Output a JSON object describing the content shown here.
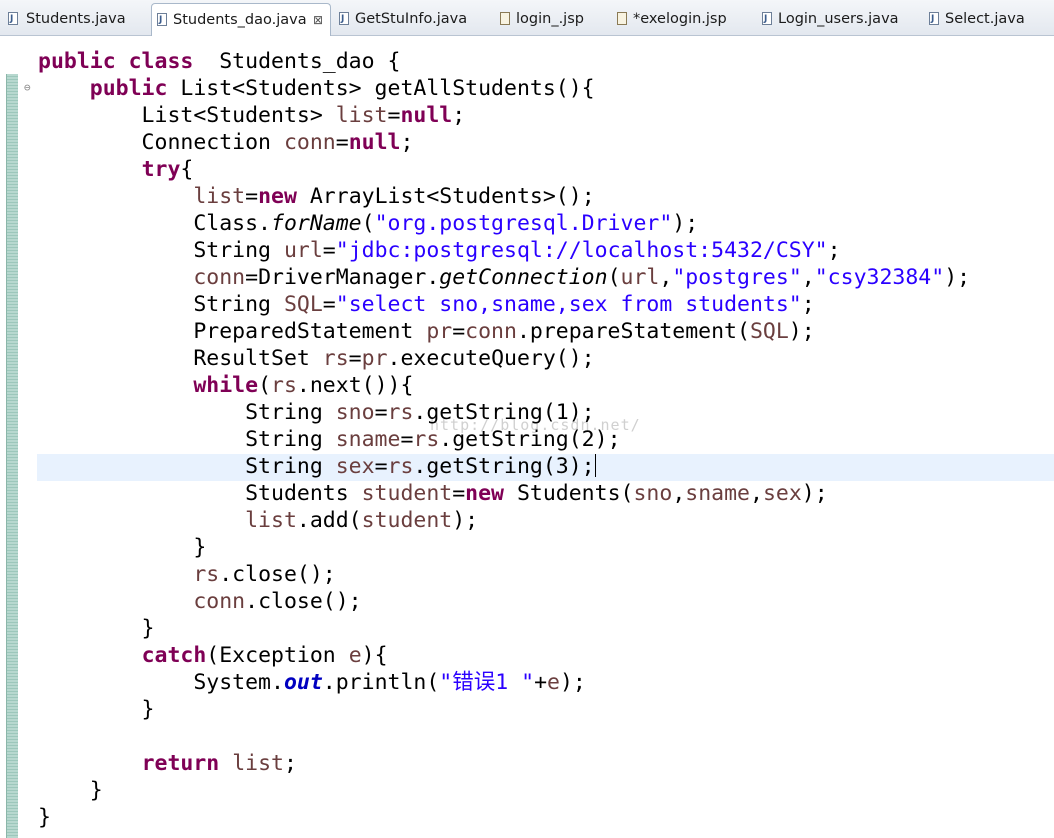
{
  "editor": {
    "tabs": [
      {
        "label": "Students.java",
        "icon": "java-file-icon"
      },
      {
        "label": "Students_dao.java",
        "icon": "java-file-icon",
        "active": true,
        "close": "⊠"
      },
      {
        "label": "GetStuInfo.java",
        "icon": "java-file-icon"
      },
      {
        "label": "login_.jsp",
        "icon": "jsp-file-icon"
      },
      {
        "label": "*exelogin.jsp",
        "icon": "jsp-file-icon"
      },
      {
        "label": "Login_users.java",
        "icon": "java-file-icon"
      },
      {
        "label": "Select.java",
        "icon": "java-file-icon"
      }
    ],
    "fold_marker": "⊖",
    "watermark": "http://blog.csdn.net/",
    "colors": {
      "keyword": "#7f0055",
      "string": "#2a00ff",
      "variable": "#6a3e3e",
      "field": "#0000c0",
      "current_line": "#e8f2fe"
    },
    "lines": [
      [
        [
          "kw",
          "public class"
        ],
        [
          "",
          "  Students_dao {"
        ]
      ],
      [
        [
          "",
          "    "
        ],
        [
          "kw",
          "public"
        ],
        [
          "",
          " List<Students> getAllStudents(){"
        ]
      ],
      [
        [
          "",
          "        List<Students> "
        ],
        [
          "var",
          "list"
        ],
        [
          "",
          "="
        ],
        [
          "kw",
          "null"
        ],
        [
          "",
          ";"
        ]
      ],
      [
        [
          "",
          "        Connection "
        ],
        [
          "var",
          "conn"
        ],
        [
          "",
          "="
        ],
        [
          "kw",
          "null"
        ],
        [
          "",
          ";"
        ]
      ],
      [
        [
          "",
          "        "
        ],
        [
          "kw",
          "try"
        ],
        [
          "",
          "{"
        ]
      ],
      [
        [
          "",
          "            "
        ],
        [
          "var",
          "list"
        ],
        [
          "",
          "="
        ],
        [
          "kw",
          "new"
        ],
        [
          "",
          " ArrayList<Students>();"
        ]
      ],
      [
        [
          "",
          "            Class."
        ],
        [
          "sm",
          "forName"
        ],
        [
          "",
          "("
        ],
        [
          "str",
          "\"org.postgresql.Driver\""
        ],
        [
          "",
          ");"
        ]
      ],
      [
        [
          "",
          "            String "
        ],
        [
          "var",
          "url"
        ],
        [
          "",
          "="
        ],
        [
          "str",
          "\"jdbc:postgresql://localhost:5432/CSY\""
        ],
        [
          "",
          ";"
        ]
      ],
      [
        [
          "",
          "            "
        ],
        [
          "var",
          "conn"
        ],
        [
          "",
          "=DriverManager."
        ],
        [
          "sm",
          "getConnection"
        ],
        [
          "",
          "("
        ],
        [
          "var",
          "url"
        ],
        [
          "",
          ","
        ],
        [
          "str",
          "\"postgres\""
        ],
        [
          "",
          ","
        ],
        [
          "str",
          "\"csy32384\""
        ],
        [
          "",
          ");"
        ]
      ],
      [
        [
          "",
          "            String "
        ],
        [
          "var",
          "SQL"
        ],
        [
          "",
          "="
        ],
        [
          "str",
          "\"select sno,sname,sex from students\""
        ],
        [
          "",
          ";"
        ]
      ],
      [
        [
          "",
          "            PreparedStatement "
        ],
        [
          "var",
          "pr"
        ],
        [
          "",
          "="
        ],
        [
          "var",
          "conn"
        ],
        [
          "",
          ".prepareStatement("
        ],
        [
          "var",
          "SQL"
        ],
        [
          "",
          ");"
        ]
      ],
      [
        [
          "",
          "            ResultSet "
        ],
        [
          "var",
          "rs"
        ],
        [
          "",
          "="
        ],
        [
          "var",
          "pr"
        ],
        [
          "",
          ".executeQuery();"
        ]
      ],
      [
        [
          "",
          "            "
        ],
        [
          "kw",
          "while"
        ],
        [
          "",
          "("
        ],
        [
          "var",
          "rs"
        ],
        [
          "",
          ".next()){"
        ]
      ],
      [
        [
          "",
          "                String "
        ],
        [
          "var",
          "sno"
        ],
        [
          "",
          "="
        ],
        [
          "var",
          "rs"
        ],
        [
          "",
          ".getString(1);"
        ]
      ],
      [
        [
          "",
          "                String "
        ],
        [
          "var",
          "sname"
        ],
        [
          "",
          "="
        ],
        [
          "var",
          "rs"
        ],
        [
          "",
          ".getString(2);"
        ]
      ],
      [
        [
          "",
          "                String "
        ],
        [
          "var",
          "sex"
        ],
        [
          "",
          "="
        ],
        [
          "var",
          "rs"
        ],
        [
          "",
          ".getString(3);"
        ],
        [
          "caret",
          ""
        ]
      ],
      [
        [
          "",
          "                Students "
        ],
        [
          "var",
          "student"
        ],
        [
          "",
          "="
        ],
        [
          "kw",
          "new"
        ],
        [
          "",
          " Students("
        ],
        [
          "var",
          "sno"
        ],
        [
          "",
          ","
        ],
        [
          "var",
          "sname"
        ],
        [
          "",
          ","
        ],
        [
          "var",
          "sex"
        ],
        [
          "",
          ");"
        ]
      ],
      [
        [
          "",
          "                "
        ],
        [
          "var",
          "list"
        ],
        [
          "",
          ".add("
        ],
        [
          "var",
          "student"
        ],
        [
          "",
          ");"
        ]
      ],
      [
        [
          "",
          "            }"
        ]
      ],
      [
        [
          "",
          "            "
        ],
        [
          "var",
          "rs"
        ],
        [
          "",
          ".close();"
        ]
      ],
      [
        [
          "",
          "            "
        ],
        [
          "var",
          "conn"
        ],
        [
          "",
          ".close();"
        ]
      ],
      [
        [
          "",
          "        }"
        ]
      ],
      [
        [
          "",
          "        "
        ],
        [
          "kw",
          "catch"
        ],
        [
          "",
          "(Exception "
        ],
        [
          "var",
          "e"
        ],
        [
          "",
          "){"
        ]
      ],
      [
        [
          "",
          "            System."
        ],
        [
          "fld",
          "out"
        ],
        [
          "",
          ".println("
        ],
        [
          "str",
          "\"错误1 \""
        ],
        [
          "",
          "+"
        ],
        [
          "var",
          "e"
        ],
        [
          "",
          ");"
        ]
      ],
      [
        [
          "",
          "        }"
        ]
      ],
      [
        [
          "",
          ""
        ]
      ],
      [
        [
          "",
          "        "
        ],
        [
          "kw",
          "return"
        ],
        [
          "",
          " "
        ],
        [
          "var",
          "list"
        ],
        [
          "",
          ";"
        ]
      ],
      [
        [
          "",
          "    }"
        ]
      ],
      [
        [
          "",
          "}"
        ]
      ]
    ]
  }
}
